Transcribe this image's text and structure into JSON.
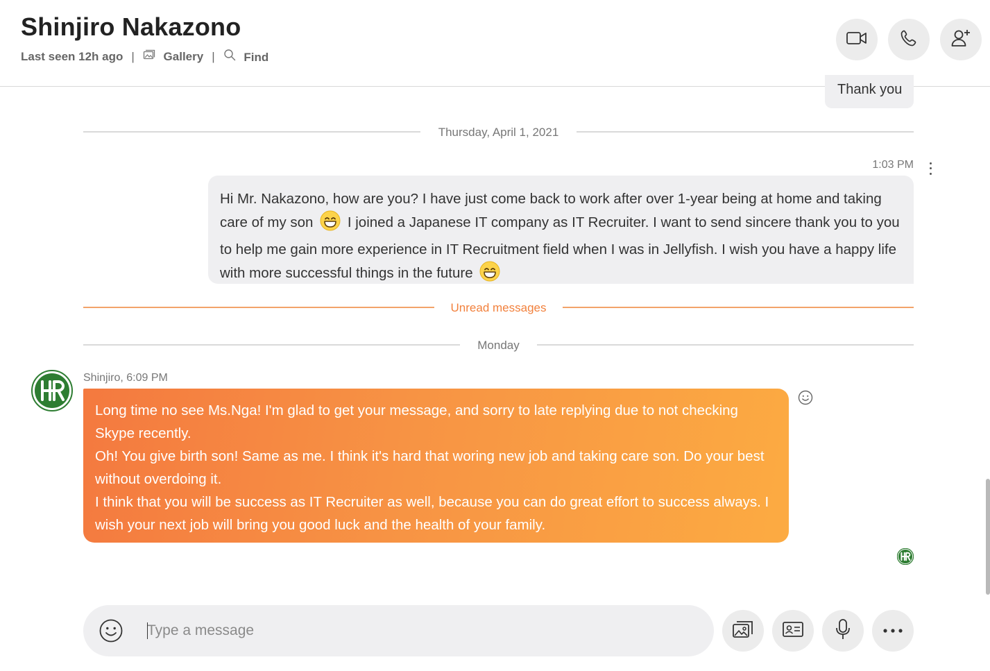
{
  "header": {
    "contact_name": "Shinjiro Nakazono",
    "last_seen": "Last seen 12h ago",
    "separator": "|",
    "gallery_label": "Gallery",
    "find_label": "Find",
    "icons": [
      "video-call-icon",
      "audio-call-icon",
      "add-person-icon",
      "gallery-icon",
      "search-icon"
    ]
  },
  "thread": {
    "previous_message": "Thank you",
    "date_divider": "Thursday, April 1, 2021",
    "outgoing_message": {
      "time": "1:03 PM",
      "text_1": "Hi Mr. Nakazono, how are you? I have just come back to work after over 1-year being at home and taking care of my son",
      "text_2": "I joined a Japanese IT company as IT Recruiter. I want to send sincere thank you to you to help me gain more experience in IT Recruitment field when I was in Jellyfish. I wish you have a happy life with more successful things in the future"
    },
    "unread_divider": "Unread messages",
    "day_divider": "Monday",
    "incoming_message": {
      "sender": "Shinjiro, 6:09 PM",
      "paragraphs": [
        "Long time no see Ms.Nga! I'm glad to get your message, and sorry to late replying due to not checking Skype recently.",
        "Oh! You give birth son! Same as me. I think it's hard that woring new job and taking care son. Do your best without overdoing it.",
        "I think that you will be success as IT Recruiter as well, because you can do great effort to success always. I wish your next job will bring you good luck and the health of your family."
      ]
    }
  },
  "composer": {
    "placeholder": "Type a message",
    "value": "",
    "icons": [
      "emoji-icon",
      "media-icon",
      "contact-card-icon",
      "microphone-icon",
      "more-icon"
    ]
  },
  "colors": {
    "accent_orange": "#f79344",
    "bubble_gradient_start": "#f4793f",
    "bubble_gradient_end": "#fcab42",
    "unread_divider": "#f3a36a",
    "avatar_green": "#2e7d32",
    "outgoing_bubble": "#efeff1"
  }
}
